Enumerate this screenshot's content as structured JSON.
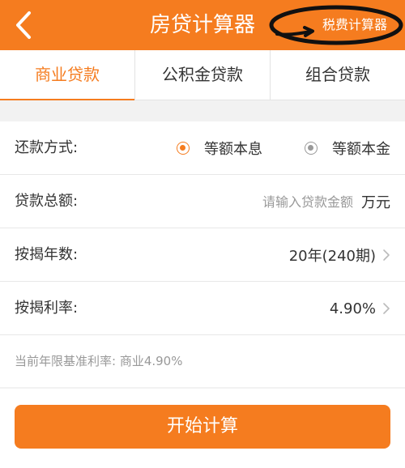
{
  "header": {
    "title": "房贷计算器",
    "tax_link": "税费计算器",
    "back_icon": "chevron-left-icon",
    "color": "#f57c1f"
  },
  "tabs": [
    {
      "label": "商业贷款",
      "active": true
    },
    {
      "label": "公积金贷款",
      "active": false
    },
    {
      "label": "组合贷款",
      "active": false
    }
  ],
  "form": {
    "repayment": {
      "label": "还款方式:",
      "options": [
        {
          "label": "等额本息",
          "selected": true
        },
        {
          "label": "等额本金",
          "selected": false
        }
      ]
    },
    "amount": {
      "label": "贷款总额:",
      "placeholder": "请输入贷款金额",
      "value": "",
      "unit": "万元"
    },
    "years": {
      "label": "按揭年数:",
      "value": "20年(240期)"
    },
    "rate": {
      "label": "按揭利率:",
      "value": "4.90%"
    },
    "hint": "当前年限基准利率: 商业4.90%"
  },
  "actions": {
    "start_label": "开始计算"
  },
  "colors": {
    "accent": "#f57c1f",
    "background": "#f2f2f2",
    "annotation": "#111111"
  }
}
